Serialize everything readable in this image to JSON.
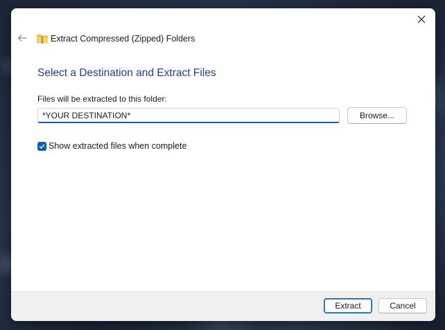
{
  "dialog": {
    "title": "Extract Compressed (Zipped) Folders",
    "heading": "Select a Destination and Extract Files",
    "folder_label": "Files will be extracted to this folder:",
    "destination_value": "*YOUR DESTINATION*",
    "browse_label": "Browse...",
    "show_files_label": "Show extracted files when complete",
    "show_files_checked": true
  },
  "footer": {
    "extract_label": "Extract",
    "cancel_label": "Cancel"
  },
  "icons": {
    "back": "back-arrow-icon",
    "close": "close-icon",
    "folder": "zip-folder-icon",
    "check": "checkmark-icon"
  },
  "colors": {
    "accent": "#0d5fb3",
    "heading": "#1e3f91"
  }
}
